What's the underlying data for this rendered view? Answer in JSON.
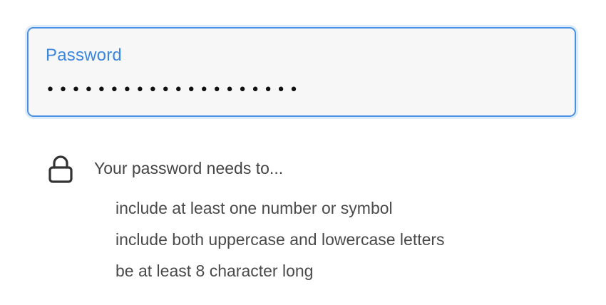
{
  "password_field": {
    "label": "Password",
    "value": "••••••••••••••••••••"
  },
  "requirements": {
    "icon": "lock-icon",
    "heading": "Your password needs to...",
    "items": [
      "include at least one number or symbol",
      "include both uppercase and lowercase letters",
      "be at least 8 character long"
    ]
  },
  "colors": {
    "accent": "#3b86e0",
    "field_background": "#f7f7f7",
    "text": "#444444"
  }
}
